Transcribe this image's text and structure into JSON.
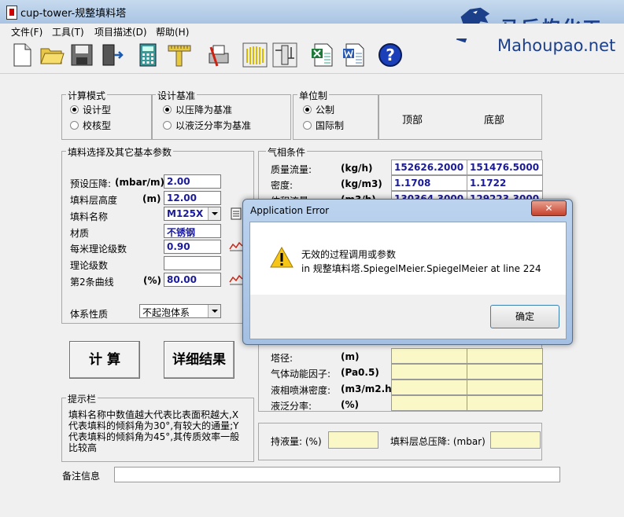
{
  "window": {
    "title": "cup-tower-规整填料塔"
  },
  "watermark": {
    "cn": "马后炮化工",
    "en": "Mahoupao.net"
  },
  "menu": [
    "文件(F)",
    "工具(T)",
    "项目描述(D)",
    "帮助(H)"
  ],
  "toolbar_icons": [
    "new-file-icon",
    "open-folder-icon",
    "save-disk-icon",
    "exit-door-icon",
    "calculator-icon",
    "ruler-icon",
    "print-icon",
    "chart-wave-icon",
    "tower-tool-icon",
    "excel-icon",
    "word-icon",
    "help-icon"
  ],
  "calc_mode": {
    "title": "计算模式",
    "options": [
      "设计型",
      "校核型"
    ],
    "selected": 0
  },
  "design_basis": {
    "title": "设计基准",
    "options": [
      "以压降为基准",
      "以液泛分率为基准"
    ],
    "selected": 0
  },
  "units": {
    "title": "单位制",
    "options": [
      "公制",
      "国际制"
    ],
    "selected": 0
  },
  "headers": {
    "top": "顶部",
    "bottom": "底部"
  },
  "packing": {
    "title": "填料选择及其它基本参数",
    "pressure_drop": {
      "label": "预设压降:",
      "unit": "(mbar/m)",
      "value": "2.00"
    },
    "height": {
      "label": "填料层高度",
      "unit": "(m)",
      "value": "12.00"
    },
    "name": {
      "label": "填料名称",
      "value": "M125X"
    },
    "material": {
      "label": "材质",
      "value": "不锈钢"
    },
    "stages_per_m": {
      "label": "每米理论级数",
      "value": "0.90"
    },
    "theoretical_stages": {
      "label": "理论级数",
      "value": ""
    },
    "curve2": {
      "label": "第2条曲线",
      "unit": "(%)",
      "value": "80.00"
    },
    "system": {
      "label": "体系性质",
      "value": "不起泡体系"
    }
  },
  "gas": {
    "title": "气相条件",
    "rows": [
      {
        "label": "质量流量:",
        "unit": "(kg/h)",
        "top": "152626.2000",
        "bottom": "151476.5000"
      },
      {
        "label": "密度:",
        "unit": "(kg/m3)",
        "top": "1.1708",
        "bottom": "1.1722"
      },
      {
        "label": "体积流量",
        "unit": "(m3/h)",
        "top": "130364.3000",
        "bottom": "129223.3000"
      }
    ]
  },
  "results": {
    "rows": [
      {
        "label": "塔径:",
        "unit": "(m)"
      },
      {
        "label": "气体动能因子:",
        "unit": "(Pa0.5)"
      },
      {
        "label": "液相喷淋密度:",
        "unit": "(m3/m2.h)"
      },
      {
        "label": "液泛分率:",
        "unit": "(%)"
      }
    ],
    "holdup_label": "持液量: (%)",
    "total_dp_label": "填料层总压降: (mbar)"
  },
  "buttons": {
    "calc": "计 算",
    "details": "详细结果"
  },
  "hint": {
    "title": "提示栏",
    "text": "填料名称中数值越大代表比表面积越大,X代表填料的倾斜角为30°,有较大的通量;Y代表填料的倾斜角为45°,其传质效率一般比较高"
  },
  "remarks": {
    "label": "备注信息"
  },
  "dialog": {
    "title": "Application Error",
    "line1": "无效的过程调用或参数",
    "line2": "in 规整填料塔.SpiegelMeier.SpiegelMeier at line 224",
    "ok": "确定"
  }
}
